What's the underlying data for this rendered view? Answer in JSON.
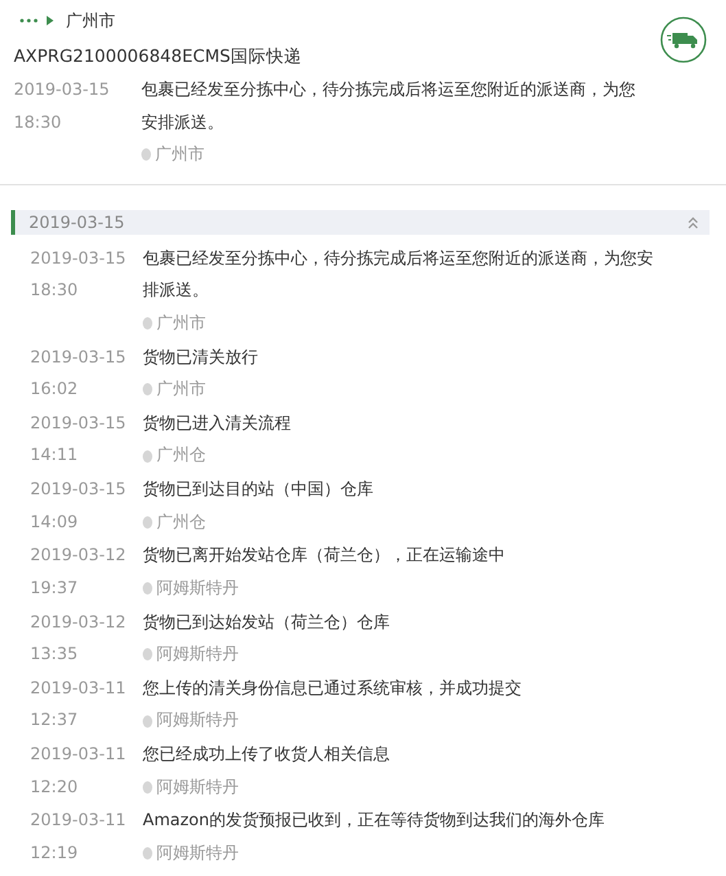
{
  "current_location": "广州市",
  "tracking": {
    "number": "AXPRG2100006848",
    "carrier": "ECMS国际快递"
  },
  "latest": {
    "date": "2019-03-15",
    "time": "18:30",
    "description": "包裹已经发至分拣中心，待分拣完成后将运至您附近的派送商，为您安排派送。",
    "location": "广州市"
  },
  "group": {
    "date": "2019-03-15",
    "expanded": true,
    "events": [
      {
        "date": "2019-03-15",
        "time": "18:30",
        "description": "包裹已经发至分拣中心，待分拣完成后将运至您附近的派送商，为您安排派送。",
        "location": "广州市"
      },
      {
        "date": "2019-03-15",
        "time": "16:02",
        "description": "货物已清关放行",
        "location": "广州市"
      },
      {
        "date": "2019-03-15",
        "time": "14:11",
        "description": "货物已进入清关流程",
        "location": "广州仓"
      },
      {
        "date": "2019-03-15",
        "time": "14:09",
        "description": "货物已到达目的站（中国）仓库",
        "location": "广州仓"
      },
      {
        "date": "2019-03-12",
        "time": "19:37",
        "description": "货物已离开始发站仓库（荷兰仓），正在运输途中",
        "location": "阿姆斯特丹"
      },
      {
        "date": "2019-03-12",
        "time": "13:35",
        "description": "货物已到达始发站（荷兰仓）仓库",
        "location": "阿姆斯特丹"
      },
      {
        "date": "2019-03-11",
        "time": "12:37",
        "description": "您上传的清关身份信息已通过系统审核，并成功提交",
        "location": "阿姆斯特丹"
      },
      {
        "date": "2019-03-11",
        "time": "12:20",
        "description": "您已经成功上传了收货人相关信息",
        "location": "阿姆斯特丹"
      },
      {
        "date": "2019-03-11",
        "time": "12:19",
        "description": "Amazon的发货预报已收到，正在等待货物到达我们的海外仓库",
        "location": "阿姆斯特丹"
      }
    ]
  }
}
